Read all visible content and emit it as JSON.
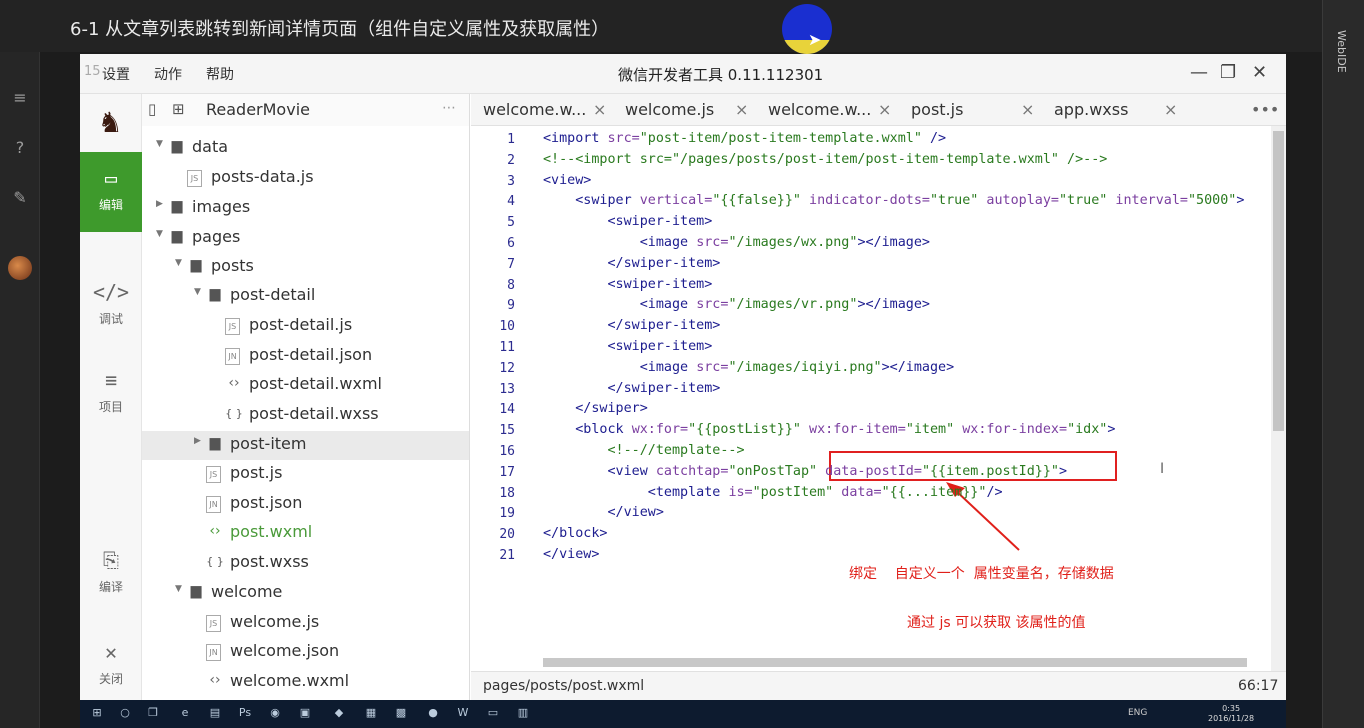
{
  "video": {
    "title": "6-1 从文章列表跳转到新闻详情页面（组件自定义属性及获取属性）",
    "side_label": "WebIDE"
  },
  "ide": {
    "title": "微信开发者工具 0.11.112301",
    "ghost_text": "15",
    "menu": [
      "设置",
      "动作",
      "帮助"
    ],
    "window_buttons": [
      "—",
      "❐",
      "✕"
    ]
  },
  "activity": [
    {
      "glyph": "▭",
      "label": "编辑",
      "active": true
    },
    {
      "glyph": "</>",
      "label": "调试",
      "active": false
    },
    {
      "glyph": "≡",
      "label": "项目",
      "active": false
    },
    {
      "glyph": "⎘",
      "label": "编译",
      "active": false
    },
    {
      "glyph": "✕",
      "label": "关闭",
      "active": false
    }
  ],
  "tree": {
    "project_name": "ReaderMovie",
    "items": [
      {
        "label": "data",
        "depth": 0,
        "type": "folder",
        "open": true
      },
      {
        "label": "posts-data.js",
        "depth": 1,
        "type": "js"
      },
      {
        "label": "images",
        "depth": 0,
        "type": "folder",
        "open": false
      },
      {
        "label": "pages",
        "depth": 0,
        "type": "folder",
        "open": true
      },
      {
        "label": "posts",
        "depth": 1,
        "type": "folder",
        "open": true
      },
      {
        "label": "post-detail",
        "depth": 2,
        "type": "folder",
        "open": true
      },
      {
        "label": "post-detail.js",
        "depth": 3,
        "type": "js"
      },
      {
        "label": "post-detail.json",
        "depth": 3,
        "type": "json"
      },
      {
        "label": "post-detail.wxml",
        "depth": 3,
        "type": "wxml"
      },
      {
        "label": "post-detail.wxss",
        "depth": 3,
        "type": "wxss"
      },
      {
        "label": "post-item",
        "depth": 2,
        "type": "folder",
        "open": false,
        "selected": true
      },
      {
        "label": "post.js",
        "depth": 2,
        "type": "js"
      },
      {
        "label": "post.json",
        "depth": 2,
        "type": "json"
      },
      {
        "label": "post.wxml",
        "depth": 2,
        "type": "wxml",
        "active": true
      },
      {
        "label": "post.wxss",
        "depth": 2,
        "type": "wxss"
      },
      {
        "label": "welcome",
        "depth": 1,
        "type": "folder",
        "open": true
      },
      {
        "label": "welcome.js",
        "depth": 2,
        "type": "js"
      },
      {
        "label": "welcome.json",
        "depth": 2,
        "type": "json"
      },
      {
        "label": "welcome.wxml",
        "depth": 2,
        "type": "wxml"
      }
    ]
  },
  "tabs": [
    "welcome.w...",
    "welcome.js",
    "welcome.w...",
    "post.js",
    "app.wxss"
  ],
  "tab_more": "•••",
  "editor": {
    "lines": [
      "1",
      "2",
      "3",
      "4",
      "5",
      "6",
      "7",
      "8",
      "9",
      "10",
      "11",
      "12",
      "13",
      "14",
      "15",
      "16",
      "17",
      "18",
      "19",
      "20",
      "21"
    ],
    "code": [
      [
        {
          "t": "<import ",
          "c": "tg"
        },
        {
          "t": "src=",
          "c": "at"
        },
        {
          "t": "\"post-item/post-item-template.wxml\"",
          "c": "st"
        },
        {
          "t": " />",
          "c": "tg"
        }
      ],
      [
        {
          "t": "<!--<import src=\"/pages/posts/post-item/post-item-template.wxml\" />-->",
          "c": "st"
        }
      ],
      [
        {
          "t": "<view>",
          "c": "tg"
        }
      ],
      [
        {
          "t": "    <swiper ",
          "c": "tg"
        },
        {
          "t": "vertical=",
          "c": "at"
        },
        {
          "t": "\"{{false}}\"",
          "c": "st"
        },
        {
          "t": " indicator-dots=",
          "c": "at"
        },
        {
          "t": "\"true\"",
          "c": "st"
        },
        {
          "t": " autoplay=",
          "c": "at"
        },
        {
          "t": "\"true\"",
          "c": "st"
        },
        {
          "t": " interval=",
          "c": "at"
        },
        {
          "t": "\"5000\"",
          "c": "st"
        },
        {
          "t": ">",
          "c": "tg"
        }
      ],
      [
        {
          "t": "        <swiper-item>",
          "c": "tg"
        }
      ],
      [
        {
          "t": "            <image ",
          "c": "tg"
        },
        {
          "t": "src=",
          "c": "at"
        },
        {
          "t": "\"/images/wx.png\"",
          "c": "st"
        },
        {
          "t": "></image>",
          "c": "tg"
        }
      ],
      [
        {
          "t": "        </swiper-item>",
          "c": "tg"
        }
      ],
      [
        {
          "t": "        <swiper-item>",
          "c": "tg"
        }
      ],
      [
        {
          "t": "            <image ",
          "c": "tg"
        },
        {
          "t": "src=",
          "c": "at"
        },
        {
          "t": "\"/images/vr.png\"",
          "c": "st"
        },
        {
          "t": "></image>",
          "c": "tg"
        }
      ],
      [
        {
          "t": "        </swiper-item>",
          "c": "tg"
        }
      ],
      [
        {
          "t": "        <swiper-item>",
          "c": "tg"
        }
      ],
      [
        {
          "t": "            <image ",
          "c": "tg"
        },
        {
          "t": "src=",
          "c": "at"
        },
        {
          "t": "\"/images/iqiyi.png\"",
          "c": "st"
        },
        {
          "t": "></image>",
          "c": "tg"
        }
      ],
      [
        {
          "t": "        </swiper-item>",
          "c": "tg"
        }
      ],
      [
        {
          "t": "    </swiper>",
          "c": "tg"
        }
      ],
      [
        {
          "t": "    <block ",
          "c": "tg"
        },
        {
          "t": "wx:for=",
          "c": "at"
        },
        {
          "t": "\"{{postList}}\"",
          "c": "st"
        },
        {
          "t": " wx:for-item=",
          "c": "at"
        },
        {
          "t": "\"item\"",
          "c": "st"
        },
        {
          "t": " wx:for-index=",
          "c": "at"
        },
        {
          "t": "\"idx\"",
          "c": "st"
        },
        {
          "t": ">",
          "c": "tg"
        }
      ],
      [
        {
          "t": "        <!--//template-->",
          "c": "st"
        }
      ],
      [
        {
          "t": "        <view ",
          "c": "tg"
        },
        {
          "t": "catchtap=",
          "c": "at"
        },
        {
          "t": "\"onPostTap\"",
          "c": "st"
        },
        {
          "t": " data-postId=",
          "c": "at"
        },
        {
          "t": "\"{{item.postId}}\"",
          "c": "st"
        },
        {
          "t": ">",
          "c": "tg"
        }
      ],
      [
        {
          "t": "             <template ",
          "c": "tg"
        },
        {
          "t": "is=",
          "c": "at"
        },
        {
          "t": "\"postItem\"",
          "c": "st"
        },
        {
          "t": " data=",
          "c": "at"
        },
        {
          "t": "\"{{...item}}\"",
          "c": "st"
        },
        {
          "t": "/>",
          "c": "tg"
        }
      ],
      [
        {
          "t": "        </view>",
          "c": "tg"
        }
      ],
      [
        {
          "t": "</block>",
          "c": "tg"
        }
      ],
      [
        {
          "t": "</view>",
          "c": "tg"
        }
      ]
    ]
  },
  "annotations": {
    "line1": "绑定    自定义一个  属性变量名，存储数据",
    "line2": "通过 js 可以获取 该属性的值",
    "color": "#e0201a"
  },
  "status": {
    "path": "pages/posts/post.wxml",
    "cursor": "66:17"
  },
  "taskbar": {
    "tray": "ENG",
    "time": "0:35",
    "date": "2016/11/28"
  },
  "colors": {
    "accent": "#3e9a2c"
  }
}
